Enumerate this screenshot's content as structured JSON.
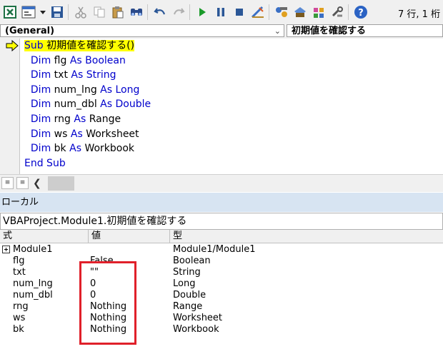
{
  "toolbar": {
    "icons": [
      "excel-icon",
      "userform-icon",
      "dropdown-arrow-icon",
      "save-icon",
      "cut-icon",
      "copy-icon",
      "paste-icon",
      "find-icon",
      "undo-icon",
      "redo-icon",
      "run-icon",
      "break-icon",
      "reset-icon",
      "design-mode-icon",
      "project-explorer-icon",
      "properties-icon",
      "object-browser-icon",
      "toolbox-icon",
      "help-icon"
    ],
    "cursor_position": "7 行, 1 桁"
  },
  "combo": {
    "object": "(General)",
    "procedure": "初期値を確認する"
  },
  "code": {
    "lines": [
      {
        "kw": "Sub",
        "rest": " 初期値を確認する()",
        "indent": "",
        "kw2": "",
        "rest2": ""
      },
      {
        "indent": "  ",
        "kw": "Dim",
        "rest": " flg ",
        "kw2": "As Boolean",
        "rest2": ""
      },
      {
        "indent": "  ",
        "kw": "Dim",
        "rest": " txt ",
        "kw2": "As String",
        "rest2": ""
      },
      {
        "indent": "  ",
        "kw": "Dim",
        "rest": " num_lng ",
        "kw2": "As Long",
        "rest2": ""
      },
      {
        "indent": "  ",
        "kw": "Dim",
        "rest": " num_dbl ",
        "kw2": "As Double",
        "rest2": ""
      },
      {
        "indent": "  ",
        "kw": "Dim",
        "rest": " rng ",
        "kw2": "As",
        "rest2": " Range"
      },
      {
        "indent": "  ",
        "kw": "Dim",
        "rest": " ws ",
        "kw2": "As",
        "rest2": " Worksheet"
      },
      {
        "indent": "  ",
        "kw": "Dim",
        "rest": " bk ",
        "kw2": "As",
        "rest2": " Workbook"
      },
      {
        "indent": "",
        "kw": "End Sub",
        "rest": "",
        "kw2": "",
        "rest2": ""
      }
    ]
  },
  "locals": {
    "title": "ローカル",
    "context": "VBAProject.Module1.初期値を確認する",
    "columns": {
      "expression": "式",
      "value": "値",
      "type": "型"
    },
    "rows": [
      {
        "expression": "Module1",
        "value": "",
        "type": "Module1/Module1"
      },
      {
        "expression": "flg",
        "value": "False",
        "type": "Boolean"
      },
      {
        "expression": "txt",
        "value": "\"\"",
        "type": "String"
      },
      {
        "expression": "num_lng",
        "value": "0",
        "type": "Long"
      },
      {
        "expression": "num_dbl",
        "value": "0",
        "type": "Double"
      },
      {
        "expression": "rng",
        "value": "Nothing",
        "type": "Range"
      },
      {
        "expression": "ws",
        "value": "Nothing",
        "type": "Worksheet"
      },
      {
        "expression": "bk",
        "value": "Nothing",
        "type": "Workbook"
      }
    ]
  },
  "colors": {
    "keyword": "#0000cc",
    "execution_highlight": "#ffff00",
    "annotation_box": "#e0202a",
    "locals_title_bg": "#d7e4f2"
  }
}
